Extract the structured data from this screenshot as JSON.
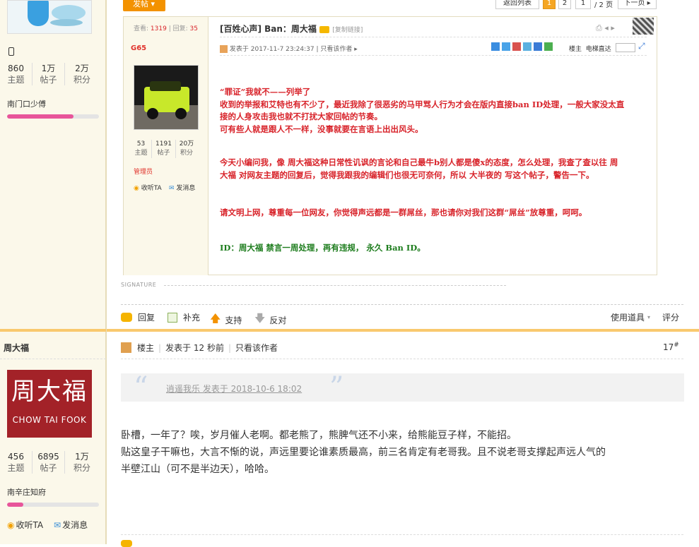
{
  "top_user": {
    "stats": [
      {
        "value": "860",
        "label": "主题"
      },
      {
        "value": "1万",
        "label": "帖子"
      },
      {
        "value": "2万",
        "label": "积分"
      }
    ],
    "rank": "南门口少傅",
    "progress": 0.72
  },
  "screenshot": {
    "reply_button": "发帖",
    "pager": {
      "back": "返回列表",
      "pages": [
        "1",
        "2"
      ],
      "page_input": "1",
      "total": "/ 2 页",
      "next": "下一页"
    },
    "views_label": "查看:",
    "views": "1319",
    "replies_label": "回复:",
    "replies": "35",
    "poster_name": "G65",
    "poster_stats": [
      {
        "value": "53",
        "label": "主题"
      },
      {
        "value": "1191",
        "label": "帖子"
      },
      {
        "value": "20万",
        "label": "积分"
      }
    ],
    "poster_group": "管理员",
    "follow": "收听TA",
    "message": "发消息",
    "thread_title": "[百姓心声] Ban：周大福",
    "copy_link": "[复制链接]",
    "posted_on": "发表于 2017-11-7 23:24:37",
    "author_only": "只看该作者",
    "floor_label": "楼主",
    "jump_label": "电梯直达",
    "body": [
      "“罪证”我就不——列举了",
      "收到的举报和艾特也有不少了，最近我除了很恶劣的马甲骂人行为才会在版内直接ban ID处理，一般大家没太直",
      "接的人身攻击我也就不打扰大家回帖的节奏。",
      "可有些人就是跟人不一样，没事就要在言语上出出风头。",
      "今天小编问我，像 周大福这种日常性讥讽的言论和自己最牛b别人都是傻x的态度，怎么处理，我查了查以往 周",
      "大福 对网友主题的回复后，觉得我跟我的编辑们也很无可奈何，所以 大半夜的 写这个帖子，警告一下。",
      "请文明上网，尊重每一位网友，你觉得声远都是一群屌丝，那也请你对我们这群“屌丝”放尊重，呵呵。",
      "ID：周大福 禁言一周处理，再有违规， 永久 Ban ID。"
    ]
  },
  "signature_label": "SIGNATURE",
  "actions": {
    "reply": "回复",
    "supplement": "补充",
    "support": "支持",
    "oppose": "反对",
    "tools": "使用道具",
    "rate": "评分"
  },
  "second_post": {
    "username": "周大福",
    "avatar_cn": "周大福",
    "avatar_en": "CHOW TAI FOOK",
    "stats": [
      {
        "value": "456",
        "label": "主题"
      },
      {
        "value": "6895",
        "label": "帖子"
      },
      {
        "value": "1万",
        "label": "积分"
      }
    ],
    "rank": "南辛庄知府",
    "progress": 0.18,
    "follow": "收听TA",
    "message": "发消息",
    "floor_label": "楼主",
    "posted_on": "发表于 12 秒前",
    "author_only": "只看该作者",
    "floor_number": "17",
    "floor_suffix": "#",
    "quote": "逍遥我乐 发表于 2018-10-6 18:02",
    "text": [
      "卧槽，一年了？唉，岁月催人老啊。都老熊了，熊脾气还不小来，给熊能豆子样，不能招。",
      "贴这皇子干嘛也，大言不惭的说，声远里要论谁素质最高，前三名肯定有老哥我。且不说老哥支撑起声远人气的",
      "半壁江山（可不是半边天），哈哈。"
    ]
  },
  "colors": {
    "sidebar_bg": "#fbf8ea",
    "accent_orange": "#f5a623",
    "body_red": "#d8232a",
    "body_green": "#1e7d1e",
    "progress_pink": "#e8559a"
  }
}
